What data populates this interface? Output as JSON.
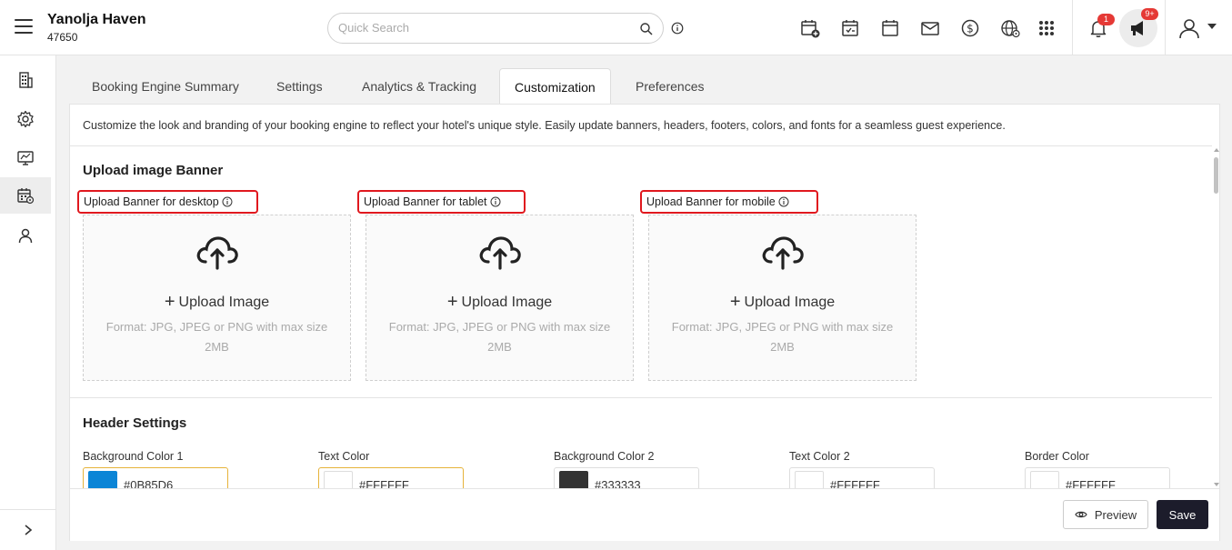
{
  "header": {
    "hotel_name": "Yanolja Haven",
    "hotel_id": "47650",
    "search_placeholder": "Quick Search",
    "notification_count": "1",
    "announcement_count": "9+"
  },
  "tabs": [
    {
      "label": "Booking Engine Summary"
    },
    {
      "label": "Settings"
    },
    {
      "label": "Analytics & Tracking"
    },
    {
      "label": "Customization",
      "active": true
    },
    {
      "label": "Preferences"
    }
  ],
  "intro": "Customize the look and branding of your booking engine to reflect your hotel's unique style. Easily update banners, headers, footers, colors, and fonts for a seamless guest experience.",
  "banner_section": {
    "title": "Upload image Banner",
    "uploads": [
      {
        "label": "Upload Banner for desktop",
        "action": "Upload Image",
        "hint": "Format: JPG, JPEG or PNG with max size 2MB"
      },
      {
        "label": "Upload Banner for tablet",
        "action": "Upload Image",
        "hint": "Format: JPG, JPEG or PNG with max size 2MB"
      },
      {
        "label": "Upload Banner for mobile",
        "action": "Upload Image",
        "hint": "Format: JPG, JPEG or PNG with max size 2MB"
      }
    ]
  },
  "header_settings": {
    "title": "Header Settings",
    "colors": [
      {
        "label": "Background Color 1",
        "value": "#0B85D6",
        "swatch": "#0B85D6"
      },
      {
        "label": "Text Color",
        "value": "#FFFFFF",
        "swatch": "#FFFFFF"
      },
      {
        "label": "Background Color 2",
        "value": "#333333",
        "swatch": "#333333"
      },
      {
        "label": "Text Color 2",
        "value": "#FFFFFF",
        "swatch": "#FFFFFF"
      },
      {
        "label": "Border Color",
        "value": "#FFFFFF",
        "swatch": "#FFFFFF"
      }
    ]
  },
  "actions": {
    "preview": "Preview",
    "save": "Save"
  },
  "theme": {
    "highlight_border": "#E0181E",
    "primary_button": "#1C1C2B",
    "badge": "#E53935"
  },
  "icons": [
    "menu-icon",
    "search-icon",
    "info-icon",
    "calendar-add-icon",
    "calendar-check-icon",
    "calendar-icon",
    "mail-icon",
    "dollar-icon",
    "globe-icon",
    "apps-grid-icon",
    "bell-icon",
    "megaphone-icon",
    "user-icon",
    "building-icon",
    "gear-icon",
    "monitor-icon",
    "calendar-settings-icon",
    "person-icon",
    "chevron-right-icon",
    "cloud-upload-icon",
    "eye-icon"
  ]
}
